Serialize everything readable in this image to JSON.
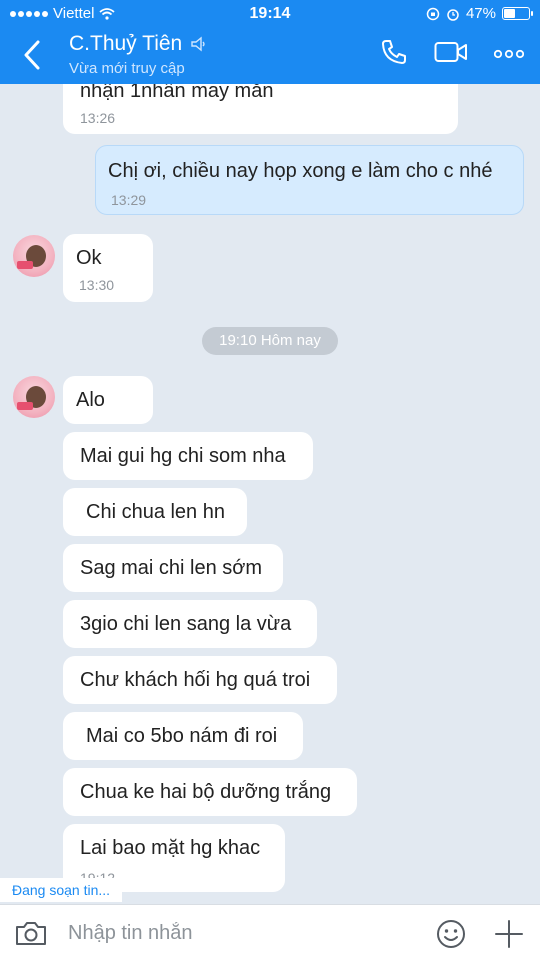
{
  "status_bar": {
    "carrier": "Viettel",
    "time": "19:14",
    "battery": "47%",
    "battery_level": 0.47
  },
  "header": {
    "title": "C.Thuỷ Tiên",
    "subtitle": "Vừa mới truy cập"
  },
  "messages": [
    {
      "text": "nhận 1nhẫn may mắn",
      "time": "13:26",
      "from": "them"
    },
    {
      "text": "Chị ơi, chiều nay họp xong e làm cho c nhé",
      "time": "13:29",
      "from": "me"
    },
    {
      "text": "Ok",
      "time": "13:30",
      "from": "them"
    },
    {
      "text": "Alo",
      "from": "them"
    },
    {
      "text": "Mai gui hg chi som nha",
      "from": "them"
    },
    {
      "text": "Chi chua len hn",
      "from": "them"
    },
    {
      "text": "Sag mai chi len sớm",
      "from": "them"
    },
    {
      "text": "3gio chi len sang la vừa",
      "from": "them"
    },
    {
      "text": "Chư khách hối hg quá troi",
      "from": "them"
    },
    {
      "text": "Mai co 5bo nám đi roi",
      "from": "them"
    },
    {
      "text": "Chua ke hai bộ dưỡng trắng",
      "from": "them"
    },
    {
      "text": "Lai bao mặt hg khac",
      "time": "19:12",
      "from": "them"
    }
  ],
  "date_separator": "19:10 Hôm nay",
  "typing_indicator": "Đang soạn tin...",
  "composer": {
    "placeholder": "Nhập tin nhắn"
  },
  "colors": {
    "header": "#1b8af2",
    "background": "#e2e9f1",
    "my_bubble": "#d6ebfe",
    "their_bubble": "#ffffff"
  }
}
